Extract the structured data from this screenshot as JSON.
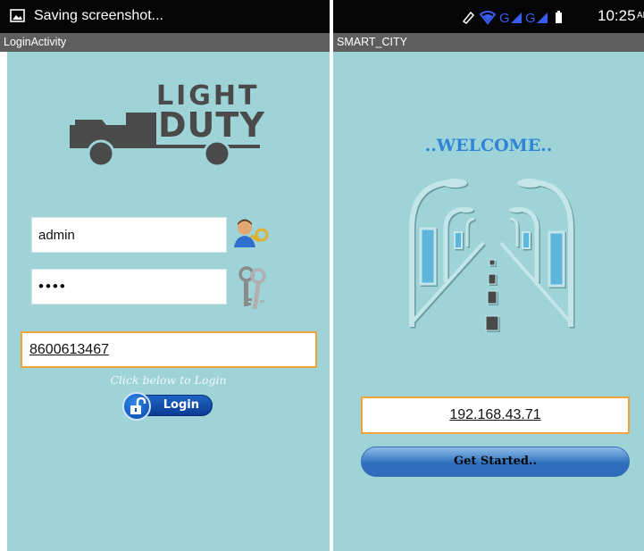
{
  "left_screen": {
    "status_bar": {
      "text": "Saving screenshot...",
      "icon": "image-icon"
    },
    "action_bar": {
      "title": "LoginActivity"
    },
    "logo": {
      "line1": "LIGHT",
      "line2": "DUTY"
    },
    "username_field": {
      "value": "admin",
      "icon": "user-key-icon"
    },
    "password_field": {
      "value": "••••",
      "icon": "keys-icon"
    },
    "phone_field": {
      "value": "8600613467"
    },
    "hint": "Click below to Login",
    "login_button": {
      "label": "Login",
      "icon": "unlock-icon"
    }
  },
  "right_screen": {
    "status_bar": {
      "time": "10:25",
      "ampm": "AM"
    },
    "action_bar": {
      "title": "SMART_CITY"
    },
    "welcome": "..WELCOME..",
    "ip_field": {
      "value": "192.168.43.71"
    },
    "get_started_button": {
      "label": "Get Started.."
    }
  },
  "colors": {
    "background": "#9ed3d8",
    "welcome_text": "#2f86d6",
    "field_focus_border": "#f0a23c",
    "button_blue": "#2d6abb",
    "status_icons": "#3b5cf0",
    "logo": "#4a4a4a"
  }
}
